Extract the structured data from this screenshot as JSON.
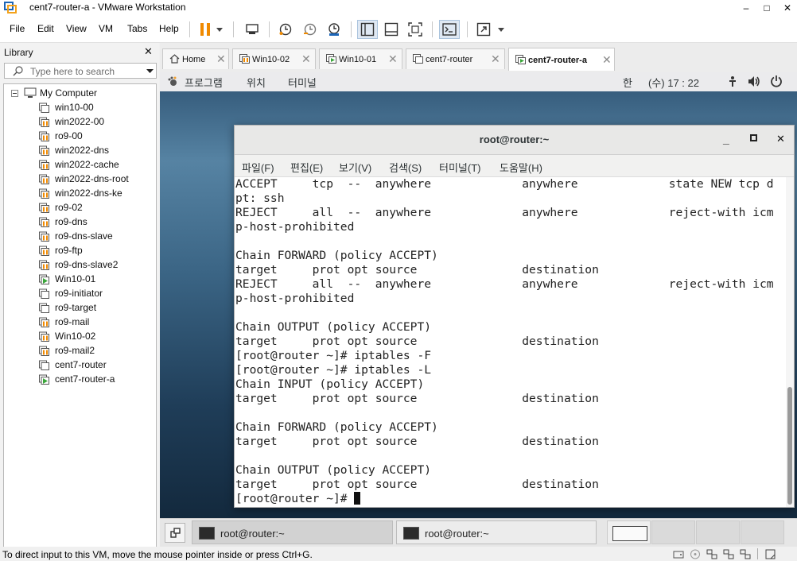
{
  "window": {
    "title": "cent7-router-a - VMware Workstation",
    "minimize": "–",
    "maximize": "□",
    "close": "✕"
  },
  "menu": {
    "items": [
      "File",
      "Edit",
      "View",
      "VM",
      "Tabs",
      "Help"
    ]
  },
  "toolbar": {
    "buttons": [
      "pause-icon",
      "dropdown-arrow-icon",
      "send-ctrl-alt-del-icon",
      "snapshot-icon",
      "revert-snapshot-icon",
      "manage-snapshots-icon",
      "show-library-icon",
      "thumbnail-bar-icon",
      "full-screen-icon",
      "console-view-icon",
      "stretch-guest-icon",
      "dropdown-arrow-icon"
    ]
  },
  "library": {
    "title": "Library",
    "close": "✕",
    "search_placeholder": "Type here to search",
    "root": "My Computer",
    "items": [
      {
        "label": "win10-00",
        "state": "off"
      },
      {
        "label": "win2022-00",
        "state": "paused"
      },
      {
        "label": "ro9-00",
        "state": "paused"
      },
      {
        "label": "win2022-dns",
        "state": "paused"
      },
      {
        "label": "win2022-cache",
        "state": "paused"
      },
      {
        "label": "win2022-dns-root",
        "state": "paused"
      },
      {
        "label": "win2022-dns-ke",
        "state": "paused"
      },
      {
        "label": "ro9-02",
        "state": "paused"
      },
      {
        "label": "ro9-dns",
        "state": "paused"
      },
      {
        "label": "ro9-dns-slave",
        "state": "paused"
      },
      {
        "label": "ro9-ftp",
        "state": "paused"
      },
      {
        "label": "ro9-dns-slave2",
        "state": "paused"
      },
      {
        "label": "Win10-01",
        "state": "running"
      },
      {
        "label": "ro9-initiator",
        "state": "off"
      },
      {
        "label": "ro9-target",
        "state": "off"
      },
      {
        "label": "ro9-mail",
        "state": "paused"
      },
      {
        "label": "Win10-02",
        "state": "paused"
      },
      {
        "label": "ro9-mail2",
        "state": "paused"
      },
      {
        "label": "cent7-router",
        "state": "off"
      },
      {
        "label": "cent7-router-a",
        "state": "running"
      }
    ]
  },
  "tabs": [
    {
      "label": "Home",
      "icon": "home-icon"
    },
    {
      "label": "Win10-02",
      "icon": "vm-paused-icon"
    },
    {
      "label": "Win10-01",
      "icon": "vm-running-icon"
    },
    {
      "label": "cent7-router",
      "icon": "vm-off-icon"
    },
    {
      "label": "cent7-router-a",
      "icon": "vm-running-icon",
      "active": true
    }
  ],
  "guest": {
    "topbar": {
      "programs": "프로그램",
      "places": "위치",
      "terminal": "터미널",
      "input_method": "한",
      "clock": "(수) 17 : 22"
    },
    "terminal": {
      "title": "root@router:~",
      "menu": [
        "파일(F)",
        "편집(E)",
        "보기(V)",
        "검색(S)",
        "터미널(T)",
        "도움말(H)"
      ],
      "lines": [
        "ACCEPT     tcp  --  anywhere             anywhere             state NEW tcp d",
        "pt: ssh",
        "REJECT     all  --  anywhere             anywhere             reject-with icm",
        "p-host-prohibited",
        "",
        "Chain FORWARD (policy ACCEPT)",
        "target     prot opt source               destination",
        "REJECT     all  --  anywhere             anywhere             reject-with icm",
        "p-host-prohibited",
        "",
        "Chain OUTPUT (policy ACCEPT)",
        "target     prot opt source               destination",
        "[root@router ~]# iptables -F",
        "[root@router ~]# iptables -L",
        "Chain INPUT (policy ACCEPT)",
        "target     prot opt source               destination",
        "",
        "Chain FORWARD (policy ACCEPT)",
        "target     prot opt source               destination",
        "",
        "Chain OUTPUT (policy ACCEPT)",
        "target     prot opt source               destination",
        "[root@router ~]# "
      ]
    },
    "taskbar": {
      "tasks": [
        "root@router:~",
        "root@router:~"
      ]
    }
  },
  "statusbar": {
    "text": "To direct input to this VM, move the mouse pointer inside or press Ctrl+G."
  }
}
